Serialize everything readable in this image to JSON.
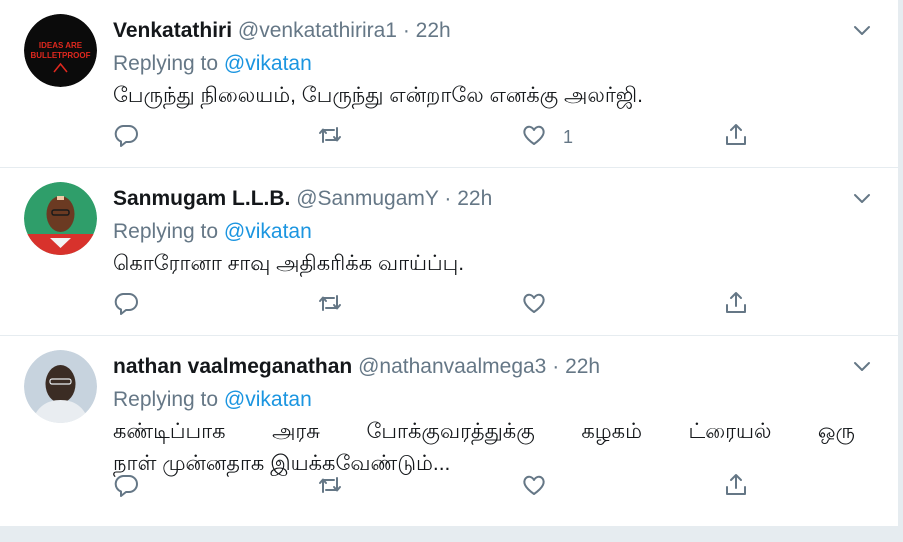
{
  "replies": [
    {
      "display_name": "Venkatathiri",
      "handle": "@venkatathirira1",
      "dot": "·",
      "time": "22h",
      "replying_prefix": "Replying to",
      "replying_to": "@vikatan",
      "text_lines": [
        "பேருந்து நிலையம், பேருந்து என்றாலே எனக்கு அலர்ஜி."
      ],
      "like_count": "1",
      "avatar": {
        "text_lines": [
          "IDEAS ARE",
          "BULLETPROOF"
        ],
        "bg": "#0b0b0b",
        "fg": "#e0281e"
      }
    },
    {
      "display_name": "Sanmugam L.L.B.",
      "handle": "@SanmugamY",
      "dot": "·",
      "time": "22h",
      "replying_prefix": "Replying to",
      "replying_to": "@vikatan",
      "text_lines": [
        "கொரோனா சாவு அதிகரிக்க வாய்ப்பு."
      ],
      "like_count": "",
      "avatar": {
        "bg": "#2f9e6a",
        "shirt": "#d8322c",
        "skin": "#6b3a22"
      }
    },
    {
      "display_name": "nathan vaalmeganathan",
      "handle": "@nathanvaalmega3",
      "dot": "·",
      "time": "22h",
      "replying_prefix": "Replying to",
      "replying_to": "@vikatan",
      "text_lines": [
        "கண்டிப்பாக அரசு போக்குவரத்துக்கு கழகம் ட்ரையல் ஒரு",
        "நாள் முன்னதாக இயக்கவேண்டும்..."
      ],
      "like_count": "",
      "avatar": {
        "bg": "#c7d3de",
        "skin": "#3b2c24",
        "shirt": "#e9edf1"
      }
    }
  ],
  "icons": [
    "reply-icon",
    "retweet-icon",
    "like-icon",
    "share-icon",
    "caret-down-icon"
  ],
  "colors": {
    "link": "#1b95e0",
    "secondary": "#657786",
    "divider": "#e6ecf0"
  }
}
